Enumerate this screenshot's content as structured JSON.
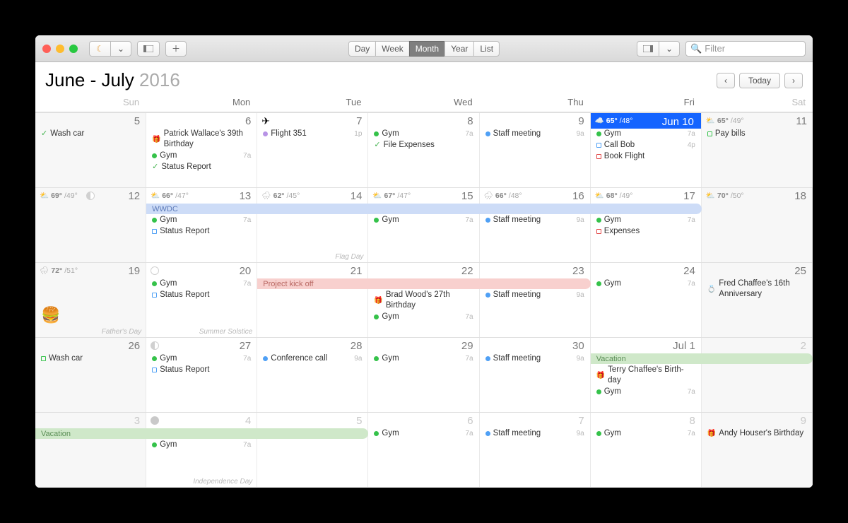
{
  "toolbar": {
    "moon_icon": "🌙",
    "views": [
      "Day",
      "Week",
      "Month",
      "Year",
      "List"
    ],
    "active_view": "Month",
    "filter_placeholder": "Filter"
  },
  "header": {
    "title_month": "June - July",
    "title_year": "2016",
    "today_label": "Today"
  },
  "dow": [
    "Sun",
    "Mon",
    "Tue",
    "Wed",
    "Thu",
    "Fri",
    "Sat"
  ],
  "banners": {
    "wwdc": "WWDC",
    "kickoff": "Project kick off",
    "vacation1": "Vacation",
    "vacation2": "Vacation"
  },
  "weeks": [
    [
      {
        "n": "5",
        "weekend": true,
        "events": [
          {
            "kind": "check",
            "label": "Wash car"
          }
        ]
      },
      {
        "n": "6",
        "events": [
          {
            "kind": "gift",
            "label": "Patrick Wallace's 39th Birthday"
          },
          {
            "kind": "dot",
            "color": "#35c24a",
            "label": "Gym",
            "time": "7a"
          },
          {
            "kind": "check",
            "label": "Status Report"
          }
        ]
      },
      {
        "n": "7",
        "plane": true,
        "events": [
          {
            "kind": "dot",
            "color": "#b893e6",
            "label": "Flight 351",
            "time": "1p"
          }
        ]
      },
      {
        "n": "8",
        "events": [
          {
            "kind": "dot",
            "color": "#35c24a",
            "label": "Gym",
            "time": "7a"
          },
          {
            "kind": "check",
            "label": "File Expenses"
          }
        ]
      },
      {
        "n": "9",
        "events": [
          {
            "kind": "dot",
            "color": "#4fa0f5",
            "label": "Staff meeting",
            "time": "9a"
          }
        ]
      },
      {
        "n": "Jun 10",
        "today": true,
        "weather": {
          "icon": "☁️",
          "hi": "65°",
          "lo": "/48°"
        },
        "events": [
          {
            "kind": "dot",
            "color": "#35c24a",
            "label": "Gym",
            "time": "7a"
          },
          {
            "kind": "sq",
            "color": "#4fa0f5",
            "label": "Call Bob",
            "time": "4p"
          },
          {
            "kind": "sq",
            "color": "#e24646",
            "label": "Book Flight"
          }
        ]
      },
      {
        "n": "11",
        "weekend": true,
        "weather": {
          "icon": "⛅",
          "hi": "65°",
          "lo": "/49°"
        },
        "events": [
          {
            "kind": "sq",
            "color": "#35c24a",
            "label": "Pay bills"
          }
        ]
      }
    ],
    [
      {
        "n": "12",
        "weekend": true,
        "weather": {
          "icon": "⛅",
          "hi": "69°",
          "lo": "/49°"
        },
        "moon": "half"
      },
      {
        "n": "13",
        "weather": {
          "icon": "⛅",
          "hi": "66°",
          "lo": "/47°"
        },
        "events": [
          {
            "kind": "dot",
            "color": "#35c24a",
            "label": "Gym",
            "time": "7a"
          },
          {
            "kind": "sq",
            "color": "#4fa0f5",
            "label": "Status Report"
          }
        ]
      },
      {
        "n": "14",
        "weather": {
          "icon": "🌧",
          "hi": "62°",
          "lo": "/45°"
        },
        "note": "Flag Day"
      },
      {
        "n": "15",
        "weather": {
          "icon": "⛅",
          "hi": "67°",
          "lo": "/47°"
        },
        "events": [
          {
            "kind": "dot",
            "color": "#35c24a",
            "label": "Gym",
            "time": "7a"
          }
        ]
      },
      {
        "n": "16",
        "weather": {
          "icon": "🌧",
          "hi": "66°",
          "lo": "/48°"
        },
        "events": [
          {
            "kind": "dot",
            "color": "#4fa0f5",
            "label": "Staff meeting",
            "time": "9a"
          }
        ]
      },
      {
        "n": "17",
        "weather": {
          "icon": "⛅",
          "hi": "68°",
          "lo": "/49°"
        },
        "events": [
          {
            "kind": "dot",
            "color": "#35c24a",
            "label": "Gym",
            "time": "7a"
          },
          {
            "kind": "sq",
            "color": "#e24646",
            "label": "Expenses"
          }
        ]
      },
      {
        "n": "18",
        "weekend": true,
        "weather": {
          "icon": "⛅",
          "hi": "70°",
          "lo": "/50°"
        }
      }
    ],
    [
      {
        "n": "19",
        "weekend": true,
        "weather": {
          "icon": "🌧",
          "hi": "72°",
          "lo": "/51°"
        },
        "note": "Father's Day",
        "burger": true
      },
      {
        "n": "20",
        "moon": "new",
        "events": [
          {
            "kind": "dot",
            "color": "#35c24a",
            "label": "Gym",
            "time": "7a"
          },
          {
            "kind": "sq",
            "color": "#4fa0f5",
            "label": "Status Report"
          }
        ],
        "note": "Summer Solstice"
      },
      {
        "n": "21"
      },
      {
        "n": "22",
        "events": [
          {
            "kind": "gift",
            "label": "Brad Wood's 27th Birthday"
          },
          {
            "kind": "dot",
            "color": "#35c24a",
            "label": "Gym",
            "time": "7a"
          }
        ]
      },
      {
        "n": "23",
        "events": [
          {
            "kind": "dot",
            "color": "#4fa0f5",
            "label": "Staff meeting",
            "time": "9a"
          }
        ]
      },
      {
        "n": "24",
        "events": [
          {
            "kind": "dot",
            "color": "#35c24a",
            "label": "Gym",
            "time": "7a"
          }
        ]
      },
      {
        "n": "25",
        "weekend": true,
        "events": [
          {
            "kind": "ring",
            "label": "Fred Chaffee's 16th Anniversary"
          }
        ]
      }
    ],
    [
      {
        "n": "26",
        "weekend": true,
        "events": [
          {
            "kind": "sq",
            "color": "#35c24a",
            "label": "Wash car"
          }
        ]
      },
      {
        "n": "27",
        "moon": "half",
        "events": [
          {
            "kind": "dot",
            "color": "#35c24a",
            "label": "Gym",
            "time": "7a"
          },
          {
            "kind": "sq",
            "color": "#4fa0f5",
            "label": "Status Report"
          }
        ]
      },
      {
        "n": "28",
        "events": [
          {
            "kind": "dot",
            "color": "#4fa0f5",
            "label": "Conference call",
            "time": "9a"
          }
        ]
      },
      {
        "n": "29",
        "events": [
          {
            "kind": "dot",
            "color": "#35c24a",
            "label": "Gym",
            "time": "7a"
          }
        ]
      },
      {
        "n": "30",
        "events": [
          {
            "kind": "dot",
            "color": "#4fa0f5",
            "label": "Staff meeting",
            "time": "9a"
          }
        ]
      },
      {
        "n": "Jul 1",
        "events": [
          {
            "kind": "gift",
            "label": "Terry Chaffee's Birth-day"
          },
          {
            "kind": "dot",
            "color": "#35c24a",
            "label": "Gym",
            "time": "7a"
          }
        ]
      },
      {
        "n": "2",
        "weekend": true,
        "other": true
      }
    ],
    [
      {
        "n": "3",
        "weekend": true,
        "other": true
      },
      {
        "n": "4",
        "other": true,
        "moon": "full",
        "events": [
          {
            "kind": "dot",
            "color": "#35c24a",
            "label": "Gym",
            "time": "7a"
          }
        ],
        "note": "Independence Day"
      },
      {
        "n": "5",
        "other": true
      },
      {
        "n": "6",
        "other": true,
        "events": [
          {
            "kind": "dot",
            "color": "#35c24a",
            "label": "Gym",
            "time": "7a"
          }
        ]
      },
      {
        "n": "7",
        "other": true,
        "events": [
          {
            "kind": "dot",
            "color": "#4fa0f5",
            "label": "Staff meeting",
            "time": "9a"
          }
        ]
      },
      {
        "n": "8",
        "other": true,
        "events": [
          {
            "kind": "dot",
            "color": "#35c24a",
            "label": "Gym",
            "time": "7a"
          }
        ]
      },
      {
        "n": "9",
        "weekend": true,
        "other": true,
        "events": [
          {
            "kind": "gift",
            "label": "Andy Houser's Birthday"
          }
        ]
      }
    ]
  ]
}
